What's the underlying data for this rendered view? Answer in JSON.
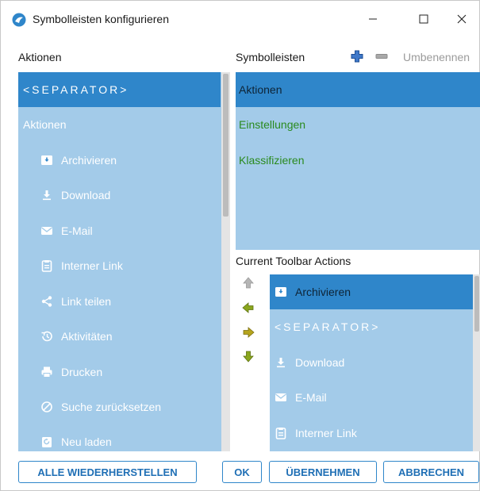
{
  "window": {
    "title": "Symbolleisten konfigurieren",
    "icon": "app-logo-icon"
  },
  "left_panel": {
    "header": "Aktionen",
    "items": [
      {
        "label": "<SEPARATOR>",
        "icon": "",
        "selected": true
      },
      {
        "label": "Aktionen",
        "icon": ""
      },
      {
        "label": "Archivieren",
        "icon": "archive-icon"
      },
      {
        "label": "Download",
        "icon": "download-icon"
      },
      {
        "label": "E-Mail",
        "icon": "mail-icon"
      },
      {
        "label": "Interner Link",
        "icon": "clipboard-icon"
      },
      {
        "label": "Link teilen",
        "icon": "share-icon"
      },
      {
        "label": "Aktivitäten",
        "icon": "history-icon"
      },
      {
        "label": "Drucken",
        "icon": "print-icon"
      },
      {
        "label": "Suche zurücksetzen",
        "icon": "block-icon"
      },
      {
        "label": "Neu laden",
        "icon": "reload-icon"
      }
    ]
  },
  "toolbars_panel": {
    "header": "Symbolleisten",
    "add_icon": "plus-icon",
    "remove_icon": "minus-icon",
    "rename_label": "Umbenennen",
    "items": [
      {
        "label": "Aktionen",
        "selected": true
      },
      {
        "label": "Einstellungen"
      },
      {
        "label": "Klassifizieren"
      }
    ]
  },
  "current_panel": {
    "header": "Current Toolbar Actions",
    "items": [
      {
        "label": "Archivieren",
        "icon": "archive-icon",
        "selected": true
      },
      {
        "label": "<SEPARATOR>",
        "icon": ""
      },
      {
        "label": "Download",
        "icon": "download-icon"
      },
      {
        "label": "E-Mail",
        "icon": "mail-icon"
      },
      {
        "label": "Interner Link",
        "icon": "clipboard-icon"
      }
    ]
  },
  "buttons": {
    "restore_all": "ALLE WIEDERHERSTELLEN",
    "ok": "OK",
    "apply": "ÜBERNEHMEN",
    "cancel": "ABBRECHEN"
  },
  "colors": {
    "list_bg": "#a3cbe9",
    "selected_bg": "#2f86ca",
    "green_text": "#2a8a1e",
    "button_border": "#2f86ca"
  }
}
